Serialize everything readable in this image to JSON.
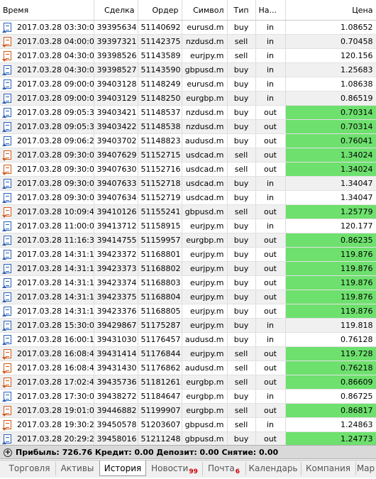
{
  "columns": {
    "time": "Время",
    "deal": "Сделка",
    "order": "Ордер",
    "symbol": "Символ",
    "type": "Тип",
    "direction": "На...",
    "price": "Цена"
  },
  "colors": {
    "highlight": "#6ee06e",
    "buy_icon": "#2b62b8",
    "sell_icon": "#cf5a1b"
  },
  "rows": [
    {
      "time": "2017.03.28 03:30:05",
      "deal": "39395634",
      "order": "51140692",
      "symbol": "eurusd.m",
      "type": "buy",
      "dir": "in",
      "price": "1.08652",
      "hl": false
    },
    {
      "time": "2017.03.28 04:00:09",
      "deal": "39397321",
      "order": "51142375",
      "symbol": "nzdusd.m",
      "type": "sell",
      "dir": "in",
      "price": "0.70458",
      "hl": false
    },
    {
      "time": "2017.03.28 04:30:01",
      "deal": "39398526",
      "order": "51143589",
      "symbol": "eurjpy.m",
      "type": "sell",
      "dir": "in",
      "price": "120.156",
      "hl": false
    },
    {
      "time": "2017.03.28 04:30:03",
      "deal": "39398527",
      "order": "51143590",
      "symbol": "gbpusd.m",
      "type": "buy",
      "dir": "in",
      "price": "1.25683",
      "hl": false
    },
    {
      "time": "2017.03.28 09:00:06",
      "deal": "39403128",
      "order": "51148249",
      "symbol": "eurusd.m",
      "type": "buy",
      "dir": "in",
      "price": "1.08638",
      "hl": false
    },
    {
      "time": "2017.03.28 09:00:06",
      "deal": "39403129",
      "order": "51148250",
      "symbol": "eurgbp.m",
      "type": "buy",
      "dir": "in",
      "price": "0.86519",
      "hl": false
    },
    {
      "time": "2017.03.28 09:05:39",
      "deal": "39403421",
      "order": "51148537",
      "symbol": "nzdusd.m",
      "type": "buy",
      "dir": "out",
      "price": "0.70314",
      "hl": true
    },
    {
      "time": "2017.03.28 09:05:39",
      "deal": "39403422",
      "order": "51148538",
      "symbol": "nzdusd.m",
      "type": "buy",
      "dir": "out",
      "price": "0.70314",
      "hl": true
    },
    {
      "time": "2017.03.28 09:06:23",
      "deal": "39403702",
      "order": "51148823",
      "symbol": "audusd.m",
      "type": "buy",
      "dir": "out",
      "price": "0.76041",
      "hl": true
    },
    {
      "time": "2017.03.28 09:30:02",
      "deal": "39407629",
      "order": "51152715",
      "symbol": "usdcad.m",
      "type": "sell",
      "dir": "out",
      "price": "1.34024",
      "hl": true
    },
    {
      "time": "2017.03.28 09:30:02",
      "deal": "39407630",
      "order": "51152716",
      "symbol": "usdcad.m",
      "type": "sell",
      "dir": "out",
      "price": "1.34024",
      "hl": true
    },
    {
      "time": "2017.03.28 09:30:02",
      "deal": "39407633",
      "order": "51152718",
      "symbol": "usdcad.m",
      "type": "buy",
      "dir": "in",
      "price": "1.34047",
      "hl": false
    },
    {
      "time": "2017.03.28 09:30:02",
      "deal": "39407634",
      "order": "51152719",
      "symbol": "usdcad.m",
      "type": "buy",
      "dir": "in",
      "price": "1.34047",
      "hl": false
    },
    {
      "time": "2017.03.28 10:09:43",
      "deal": "39410126",
      "order": "51155241",
      "symbol": "gbpusd.m",
      "type": "sell",
      "dir": "out",
      "price": "1.25779",
      "hl": true
    },
    {
      "time": "2017.03.28 11:00:03",
      "deal": "39413712",
      "order": "51158915",
      "symbol": "eurjpy.m",
      "type": "buy",
      "dir": "in",
      "price": "120.177",
      "hl": false
    },
    {
      "time": "2017.03.28 11:16:32",
      "deal": "39414755",
      "order": "51159957",
      "symbol": "eurgbp.m",
      "type": "buy",
      "dir": "out",
      "price": "0.86235",
      "hl": true
    },
    {
      "time": "2017.03.28 14:31:12",
      "deal": "39423372",
      "order": "51168801",
      "symbol": "eurjpy.m",
      "type": "buy",
      "dir": "out",
      "price": "119.876",
      "hl": true
    },
    {
      "time": "2017.03.28 14:31:12",
      "deal": "39423373",
      "order": "51168802",
      "symbol": "eurjpy.m",
      "type": "buy",
      "dir": "out",
      "price": "119.876",
      "hl": true
    },
    {
      "time": "2017.03.28 14:31:12",
      "deal": "39423374",
      "order": "51168803",
      "symbol": "eurjpy.m",
      "type": "buy",
      "dir": "out",
      "price": "119.876",
      "hl": true
    },
    {
      "time": "2017.03.28 14:31:12",
      "deal": "39423375",
      "order": "51168804",
      "symbol": "eurjpy.m",
      "type": "buy",
      "dir": "out",
      "price": "119.876",
      "hl": true
    },
    {
      "time": "2017.03.28 14:31:12",
      "deal": "39423376",
      "order": "51168805",
      "symbol": "eurjpy.m",
      "type": "buy",
      "dir": "out",
      "price": "119.876",
      "hl": true
    },
    {
      "time": "2017.03.28 15:30:02",
      "deal": "39429867",
      "order": "51175287",
      "symbol": "eurjpy.m",
      "type": "buy",
      "dir": "in",
      "price": "119.818",
      "hl": false
    },
    {
      "time": "2017.03.28 16:00:19",
      "deal": "39431030",
      "order": "51176457",
      "symbol": "audusd.m",
      "type": "buy",
      "dir": "in",
      "price": "0.76128",
      "hl": false
    },
    {
      "time": "2017.03.28 16:08:44",
      "deal": "39431414",
      "order": "51176844",
      "symbol": "eurjpy.m",
      "type": "sell",
      "dir": "out",
      "price": "119.728",
      "hl": true
    },
    {
      "time": "2017.03.28 16:08:48",
      "deal": "39431430",
      "order": "51176862",
      "symbol": "audusd.m",
      "type": "sell",
      "dir": "out",
      "price": "0.76218",
      "hl": true
    },
    {
      "time": "2017.03.28 17:02:45",
      "deal": "39435736",
      "order": "51181261",
      "symbol": "eurgbp.m",
      "type": "sell",
      "dir": "out",
      "price": "0.86609",
      "hl": true
    },
    {
      "time": "2017.03.28 17:30:08",
      "deal": "39438272",
      "order": "51184647",
      "symbol": "eurgbp.m",
      "type": "buy",
      "dir": "in",
      "price": "0.86725",
      "hl": false
    },
    {
      "time": "2017.03.28 19:01:03",
      "deal": "39446882",
      "order": "51199907",
      "symbol": "eurgbp.m",
      "type": "sell",
      "dir": "out",
      "price": "0.86817",
      "hl": true
    },
    {
      "time": "2017.03.28 19:30:27",
      "deal": "39450578",
      "order": "51203607",
      "symbol": "gbpusd.m",
      "type": "sell",
      "dir": "in",
      "price": "1.24863",
      "hl": false
    },
    {
      "time": "2017.03.28 20:29:28",
      "deal": "39458016",
      "order": "51211248",
      "symbol": "gbpusd.m",
      "type": "buy",
      "dir": "out",
      "price": "1.24773",
      "hl": true
    }
  ],
  "summary": {
    "text": "Прибыль: 726.76  Кредит: 0.00  Депозит: 0.00  Снятие: 0.00",
    "expand_icon": "+"
  },
  "tabs": [
    {
      "label": "Торговля",
      "badge": ""
    },
    {
      "label": "Активы",
      "badge": ""
    },
    {
      "label": "История",
      "badge": "",
      "active": true
    },
    {
      "label": "Новости",
      "badge": "99"
    },
    {
      "label": "Почта",
      "badge": "6"
    },
    {
      "label": "Календарь",
      "badge": ""
    },
    {
      "label": "Компания",
      "badge": ""
    },
    {
      "label": "Мар",
      "badge": ""
    }
  ]
}
